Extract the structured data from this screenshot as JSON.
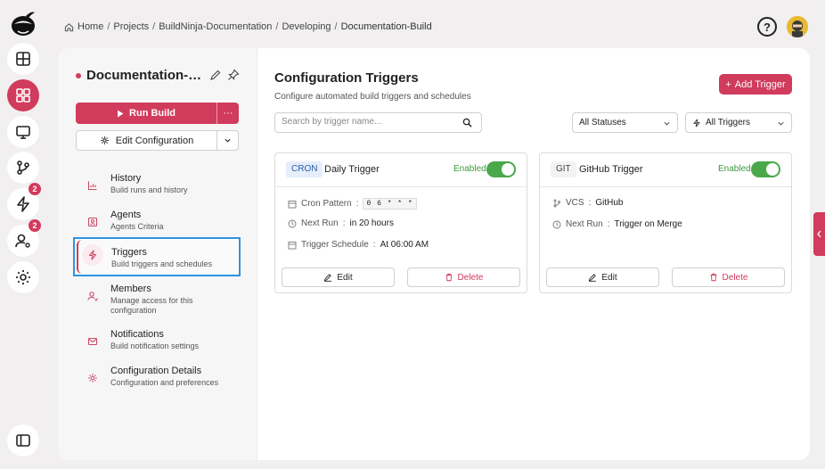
{
  "breadcrumb": {
    "items": [
      "Home",
      "Projects",
      "BuildNinja-Documentation",
      "Developing",
      "Documentation-Build"
    ]
  },
  "rail": {
    "badges": {
      "triggers": "2",
      "members": "2"
    }
  },
  "project": {
    "title": "Documentation-Build",
    "run_label": "Run Build",
    "more_label": "···",
    "edit_label": "Edit Configuration"
  },
  "nav": [
    {
      "title": "History",
      "sub": "Build runs and history",
      "icon": "chart-icon"
    },
    {
      "title": "Agents",
      "sub": "Agents Criteria",
      "icon": "agent-icon"
    },
    {
      "title": "Triggers",
      "sub": "Build triggers and schedules",
      "icon": "lightning-icon"
    },
    {
      "title": "Members",
      "sub": "Manage access for this configuration",
      "icon": "members-icon"
    },
    {
      "title": "Notifications",
      "sub": "Build notification settings",
      "icon": "mail-icon"
    },
    {
      "title": "Configuration Details",
      "sub": "Configuration and preferences",
      "icon": "gear-icon"
    }
  ],
  "main": {
    "title": "Configuration Triggers",
    "subtitle": "Configure automated build triggers and schedules",
    "add_label": "Add Trigger",
    "search_placeholder": "Search by trigger name...",
    "status_filter": "All Statuses",
    "type_filter": "All Triggers"
  },
  "cards": [
    {
      "tag": "CRON",
      "name": "Daily Trigger",
      "status": "Enabled",
      "details": [
        {
          "label": "Cron Pattern",
          "value": "0 6 * * *"
        },
        {
          "label": "Next Run",
          "value": "in 20 hours"
        },
        {
          "label": "Trigger Schedule",
          "value": "At 06:00 AM"
        }
      ],
      "edit_label": "Edit",
      "delete_label": "Delete"
    },
    {
      "tag": "GIT",
      "name": "GitHub Trigger",
      "status": "Enabled",
      "details": [
        {
          "label": "VCS",
          "value": "GitHub"
        },
        {
          "label": "Next Run",
          "value": "Trigger on Merge"
        }
      ],
      "edit_label": "Edit",
      "delete_label": "Delete"
    }
  ],
  "colors": {
    "accent": "#d13b5c",
    "enabled": "#4aa84a",
    "focus": "#2f93e0"
  }
}
